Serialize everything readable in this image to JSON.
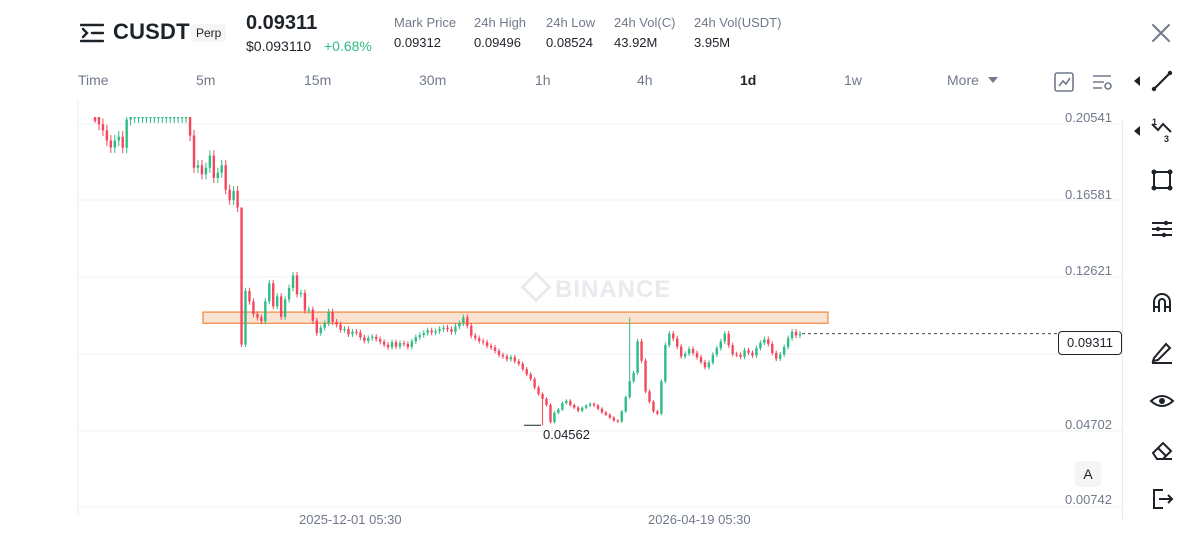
{
  "header": {
    "symbol": "CUSDT",
    "badge": "Perp",
    "last_price": "0.09311",
    "usd_price": "$0.093110",
    "change": "+0.68%",
    "stats": [
      {
        "label": "Mark Price",
        "value": "0.09312"
      },
      {
        "label": "24h High",
        "value": "0.09496"
      },
      {
        "label": "24h Low",
        "value": "0.08524"
      },
      {
        "label": "24h Vol(C)",
        "value": "43.92M"
      },
      {
        "label": "24h Vol(USDT)",
        "value": "3.95M"
      }
    ]
  },
  "timeframes": [
    "Time",
    "5m",
    "15m",
    "30m",
    "1h",
    "4h",
    "1d",
    "1w",
    "More"
  ],
  "active_timeframe": "1d",
  "chart_data": {
    "type": "candlestick",
    "watermark": "BINANCE",
    "y_ticks": [
      "0.20541",
      "0.16581",
      "0.12621",
      "0.04702",
      "0.00742"
    ],
    "x_ticks": [
      "2025-12-01 05:30",
      "2026-04-19 05:30"
    ],
    "ylim": [
      0.00742,
      0.20541
    ],
    "current_price": "0.09311",
    "low_annotation": "0.04562",
    "highlight_zone": [
      0.0985,
      0.1043
    ],
    "colors": {
      "up": "#2ebd85",
      "down": "#f6465d",
      "zone_fill": "#fbe3d4",
      "zone_stroke": "#f0883e"
    },
    "closes": [
      0.2054,
      0.2016,
      0.1985,
      0.1932,
      0.1896,
      0.1932,
      0.1952,
      0.1895,
      0.2041,
      0.2054,
      0.2054,
      0.2054,
      0.2054,
      0.2054,
      0.2054,
      0.2054,
      0.2054,
      0.2054,
      0.2054,
      0.2054,
      0.2054,
      0.2054,
      0.2054,
      0.2054,
      0.1958,
      0.1791,
      0.1804,
      0.1757,
      0.1791,
      0.1854,
      0.1738,
      0.1765,
      0.1804,
      0.1678,
      0.1623,
      0.1671,
      0.1585,
      0.0875,
      0.1152,
      0.1098,
      0.1032,
      0.1015,
      0.0995,
      0.1099,
      0.1192,
      0.1073,
      0.1124,
      0.1018,
      0.1109,
      0.1168,
      0.1233,
      0.1136,
      0.1142,
      0.1051,
      0.1056,
      0.0998,
      0.0934,
      0.0962,
      0.0985,
      0.1045,
      0.0992,
      0.0978,
      0.0951,
      0.0955,
      0.0928,
      0.0941,
      0.0937,
      0.0912,
      0.0894,
      0.0908,
      0.0915,
      0.0903,
      0.0889,
      0.0874,
      0.0861,
      0.0887,
      0.0864,
      0.0882,
      0.0878,
      0.0862,
      0.0891,
      0.0913,
      0.0924,
      0.0935,
      0.0948,
      0.0937,
      0.0944,
      0.0955,
      0.0962,
      0.0954,
      0.0941,
      0.0968,
      0.0985,
      0.1015,
      0.0972,
      0.0921,
      0.0908,
      0.0893,
      0.0887,
      0.0868,
      0.0859,
      0.0842,
      0.0821,
      0.0813,
      0.0798,
      0.0809,
      0.0788,
      0.0775,
      0.0747,
      0.0721,
      0.0696,
      0.0652,
      0.0618,
      0.0593,
      0.0562,
      0.0473,
      0.0521,
      0.0538,
      0.0571,
      0.0583,
      0.0561,
      0.0548,
      0.0532,
      0.0547,
      0.0558,
      0.0567,
      0.0559,
      0.0542,
      0.0523,
      0.0511,
      0.0496,
      0.0481,
      0.0476,
      0.0528,
      0.0602,
      0.0685,
      0.0728,
      0.0892,
      0.0791,
      0.0632,
      0.0578,
      0.0528,
      0.0516,
      0.0684,
      0.0872,
      0.0931,
      0.0906,
      0.0864,
      0.0813,
      0.0828,
      0.0852,
      0.0831,
      0.0809,
      0.0784,
      0.0757,
      0.0781,
      0.0822,
      0.0856,
      0.0891,
      0.0931,
      0.0871,
      0.0825,
      0.0822,
      0.0811,
      0.0845,
      0.0832,
      0.0818,
      0.0856,
      0.0884,
      0.0902,
      0.0878,
      0.0831,
      0.0801,
      0.0823,
      0.0862,
      0.0908,
      0.0941,
      0.0922,
      0.0931
    ]
  },
  "side_tools": [
    "trend-line-icon",
    "fibonacci-icon",
    "rectangle-icon",
    "settings-lines-icon",
    "magnet-icon",
    "pen-icon",
    "eye-icon",
    "eraser-icon",
    "exit-icon"
  ],
  "auto_label": "A"
}
